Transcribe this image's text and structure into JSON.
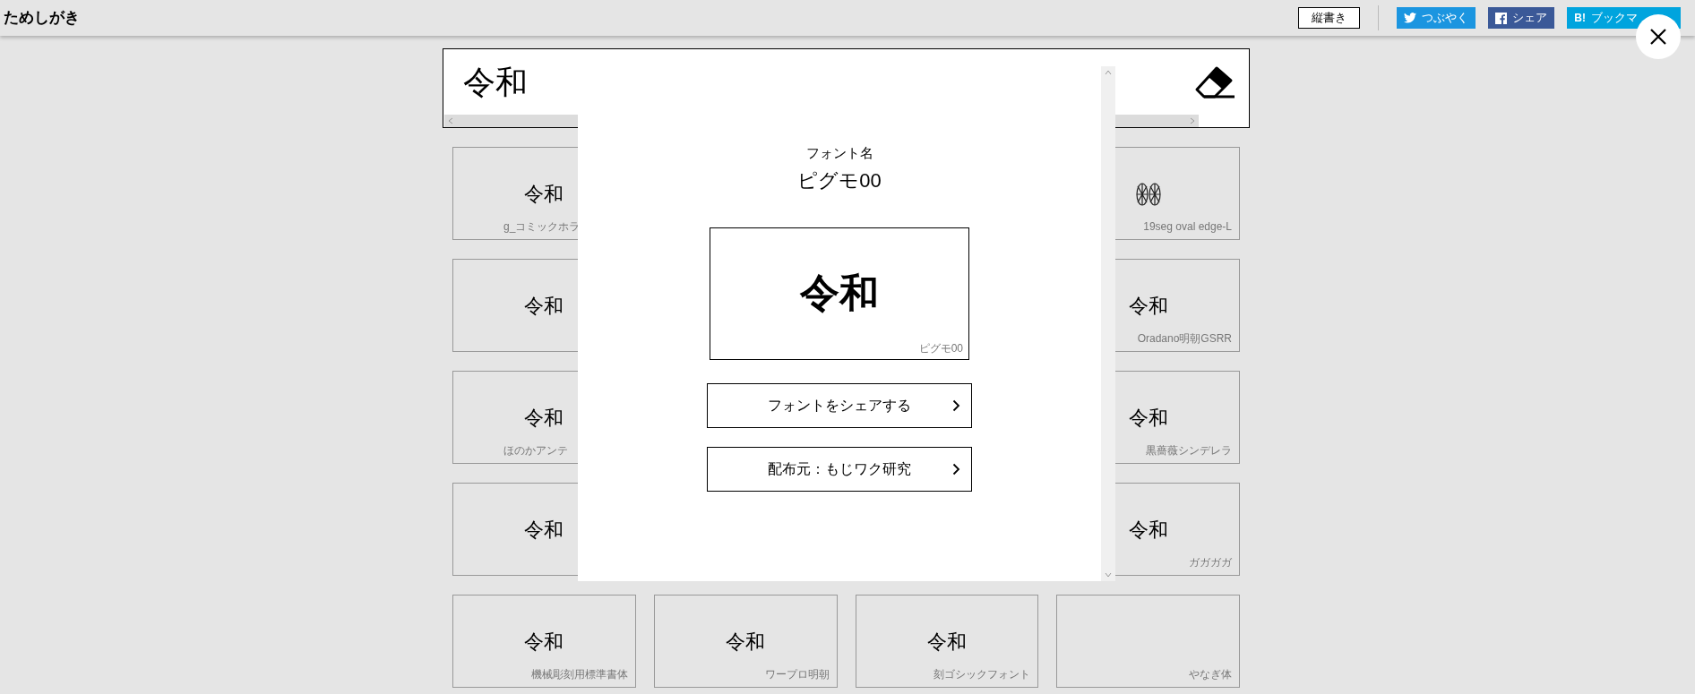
{
  "header": {
    "title": "ためしがき",
    "vertical_button": "縦書き",
    "share_buttons": [
      {
        "kind": "twitter",
        "label": "つぶやく"
      },
      {
        "kind": "facebook",
        "label": "シェア"
      },
      {
        "kind": "hatena",
        "badge": "B!",
        "label": "ブックマ"
      }
    ]
  },
  "input": {
    "value": "令和"
  },
  "card_rows": [
    {
      "cards": [
        {
          "kind": "text",
          "sample": "令和",
          "label": "g_コミックホラ"
        },
        {
          "kind": "segment",
          "label": "19seg oval edge-L"
        }
      ]
    },
    {
      "cards": [
        {
          "kind": "text",
          "sample": "令和"
        },
        {
          "kind": "text",
          "sample": "令和",
          "label": "Oradano明朝GSRR"
        }
      ]
    },
    {
      "cards": [
        {
          "kind": "text",
          "sample": "令和",
          "label": "ほのかアンテ"
        },
        {
          "kind": "text",
          "sample": "令和",
          "label": "黒薔薇シンデレラ"
        }
      ]
    },
    {
      "cards": [
        {
          "kind": "text",
          "sample": "令和"
        },
        {
          "kind": "text",
          "sample": "令和",
          "label": "ガガガガ"
        }
      ]
    },
    {
      "cards": [
        {
          "kind": "text",
          "sample": "令和",
          "label": "機械彫刻用標準書体"
        },
        {
          "kind": "text",
          "sample": "令和",
          "label": "ワープロ明朝"
        },
        {
          "kind": "text",
          "sample": "令和",
          "label": "刻ゴシックフォント"
        },
        {
          "kind": "blank",
          "label": "やなぎ体"
        }
      ]
    }
  ],
  "modal": {
    "caption": "フォント名",
    "font_name": "ピグモ00",
    "preview_text": "令和",
    "preview_label": "ピグモ00",
    "links": [
      "フォントをシェアする",
      "配布元：もじワク研究"
    ]
  }
}
